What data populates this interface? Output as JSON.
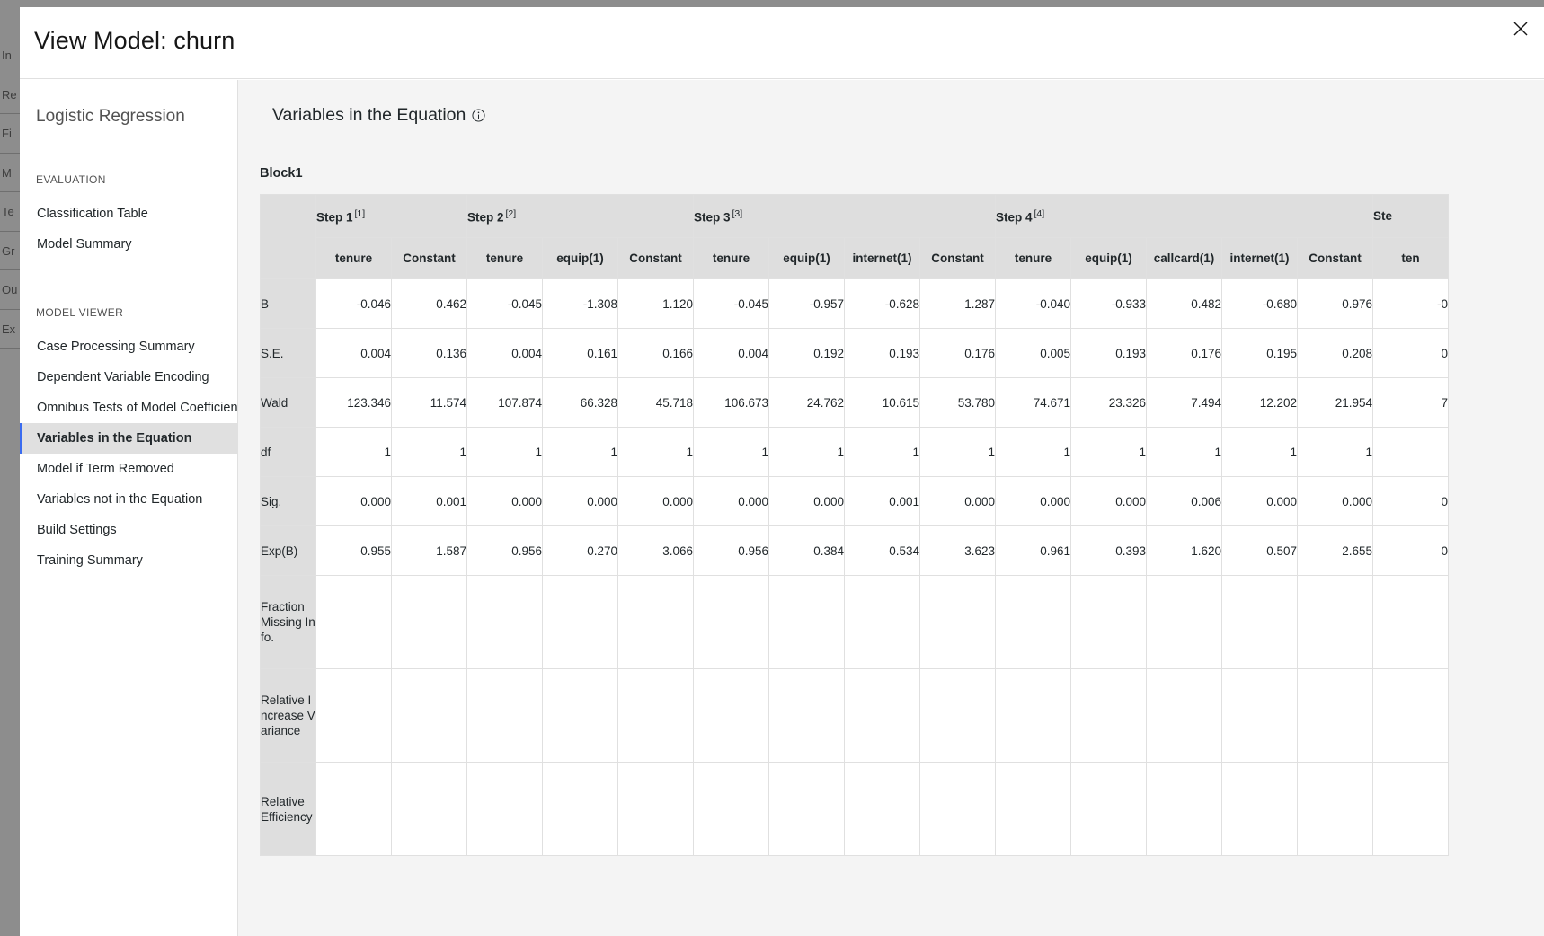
{
  "background": {
    "rows": [
      "In",
      "Re",
      "Fi",
      "M",
      "Te",
      "Gr",
      "Ou",
      "Ex"
    ]
  },
  "modal": {
    "title": "View Model: churn",
    "close_icon": "close-icon",
    "close_label": "Close"
  },
  "sidebar": {
    "heading": "Logistic Regression",
    "sections": [
      {
        "label": "EVALUATION",
        "items": [
          {
            "label": "Classification Table",
            "selected": false
          },
          {
            "label": "Model Summary",
            "selected": false
          }
        ]
      },
      {
        "label": "MODEL VIEWER",
        "items": [
          {
            "label": "Case Processing Summary",
            "selected": false
          },
          {
            "label": "Dependent Variable Encoding",
            "selected": false
          },
          {
            "label": "Omnibus Tests of Model Coefficients",
            "selected": false
          },
          {
            "label": "Variables in the Equation",
            "selected": true
          },
          {
            "label": "Model if Term Removed",
            "selected": false
          },
          {
            "label": "Variables not in the Equation",
            "selected": false
          },
          {
            "label": "Build Settings",
            "selected": false
          },
          {
            "label": "Training Summary",
            "selected": false
          }
        ]
      }
    ]
  },
  "main": {
    "title": "Variables in the Equation",
    "info_icon": "info-icon",
    "block_label": "Block1"
  },
  "chart_data": {
    "type": "table",
    "title": "Variables in the Equation",
    "block": "Block1",
    "step_groups": [
      {
        "label": "Step 1",
        "footnote": "[1]",
        "columns": [
          "tenure",
          "Constant"
        ]
      },
      {
        "label": "Step 2",
        "footnote": "[2]",
        "columns": [
          "tenure",
          "equip(1)",
          "Constant"
        ]
      },
      {
        "label": "Step 3",
        "footnote": "[3]",
        "columns": [
          "tenure",
          "equip(1)",
          "internet(1)",
          "Constant"
        ]
      },
      {
        "label": "Step 4",
        "footnote": "[4]",
        "columns": [
          "tenure",
          "equip(1)",
          "callcard(1)",
          "internet(1)",
          "Constant"
        ]
      },
      {
        "label": "Ste",
        "footnote": "",
        "columns": [
          "ten"
        ]
      }
    ],
    "row_labels": [
      "B",
      "S.E.",
      "Wald",
      "df",
      "Sig.",
      "Exp(B)",
      "Fraction Missing Info.",
      "Relative Increase Variance",
      "Relative Efficiency"
    ],
    "rows": [
      {
        "label": "B",
        "values": [
          "-0.046",
          "0.462",
          "-0.045",
          "-1.308",
          "1.120",
          "-0.045",
          "-0.957",
          "-0.628",
          "1.287",
          "-0.040",
          "-0.933",
          "0.482",
          "-0.680",
          "0.976",
          "-0"
        ]
      },
      {
        "label": "S.E.",
        "values": [
          "0.004",
          "0.136",
          "0.004",
          "0.161",
          "0.166",
          "0.004",
          "0.192",
          "0.193",
          "0.176",
          "0.005",
          "0.193",
          "0.176",
          "0.195",
          "0.208",
          "0"
        ]
      },
      {
        "label": "Wald",
        "values": [
          "123.346",
          "11.574",
          "107.874",
          "66.328",
          "45.718",
          "106.673",
          "24.762",
          "10.615",
          "53.780",
          "74.671",
          "23.326",
          "7.494",
          "12.202",
          "21.954",
          "7"
        ]
      },
      {
        "label": "df",
        "values": [
          "1",
          "1",
          "1",
          "1",
          "1",
          "1",
          "1",
          "1",
          "1",
          "1",
          "1",
          "1",
          "1",
          "1",
          ""
        ]
      },
      {
        "label": "Sig.",
        "values": [
          "0.000",
          "0.001",
          "0.000",
          "0.000",
          "0.000",
          "0.000",
          "0.000",
          "0.001",
          "0.000",
          "0.000",
          "0.000",
          "0.006",
          "0.000",
          "0.000",
          "0"
        ]
      },
      {
        "label": "Exp(B)",
        "values": [
          "0.955",
          "1.587",
          "0.956",
          "0.270",
          "3.066",
          "0.956",
          "0.384",
          "0.534",
          "3.623",
          "0.961",
          "0.393",
          "1.620",
          "0.507",
          "2.655",
          "0"
        ]
      },
      {
        "label": "Fraction Missing Info.",
        "values": [
          "",
          "",
          "",
          "",
          "",
          "",
          "",
          "",
          "",
          "",
          "",
          "",
          "",
          "",
          ""
        ]
      },
      {
        "label": "Relative Increase Variance",
        "values": [
          "",
          "",
          "",
          "",
          "",
          "",
          "",
          "",
          "",
          "",
          "",
          "",
          "",
          "",
          ""
        ]
      },
      {
        "label": "Relative Efficiency",
        "values": [
          "",
          "",
          "",
          "",
          "",
          "",
          "",
          "",
          "",
          "",
          "",
          "",
          "",
          "",
          ""
        ]
      }
    ]
  },
  "colors": {
    "accent": "#3b6cf0",
    "panel_bg": "#f4f4f4",
    "header_cell": "#dedede",
    "border": "#e0e0e0",
    "text": "#21272a"
  }
}
